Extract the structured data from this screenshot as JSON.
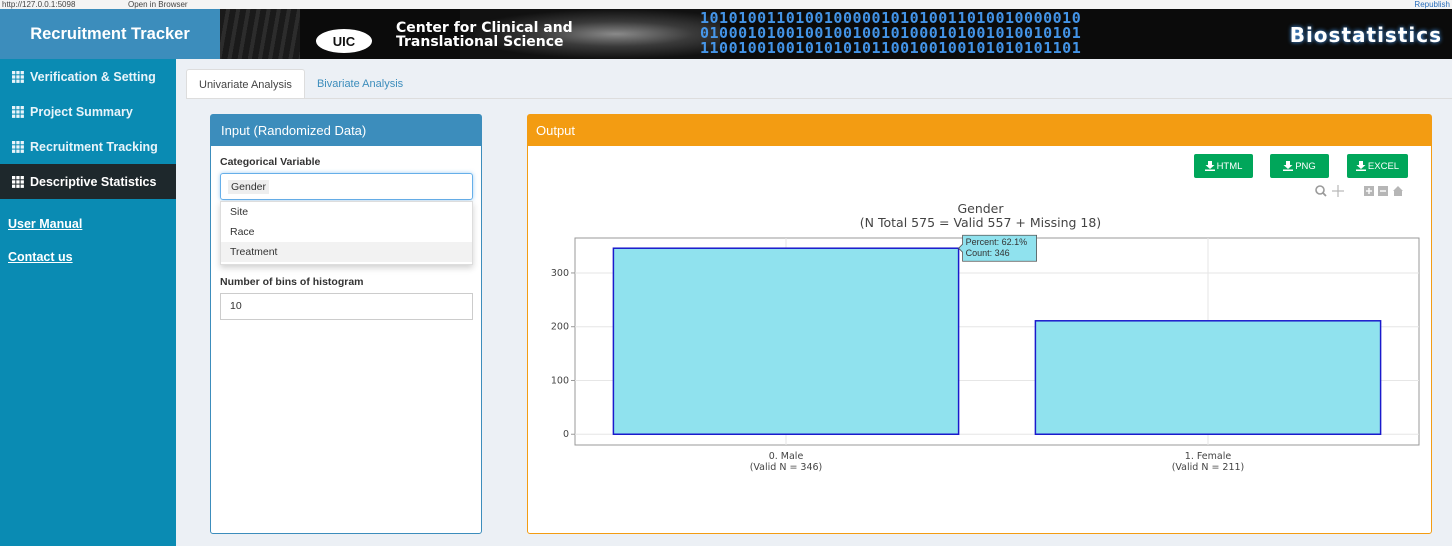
{
  "browser": {
    "url": "http://127.0.0.1:5098",
    "open_in_browser": "Open in Browser",
    "republish": "Republish"
  },
  "header": {
    "app_title": "Recruitment Tracker",
    "banner_logo": "UIC",
    "banner_line1": "Center for Clinical and",
    "banner_line2": "Translational Science",
    "banner_right": "Biostatistics",
    "banner_binary": [
      "1010100110100100000101010011010010000010",
      "0100010100100100100101000101001010010101",
      "1100100100101010101100100100101010101101"
    ]
  },
  "sidebar": {
    "items": [
      {
        "label": "Verification & Setting",
        "icon": "table-icon"
      },
      {
        "label": "Project Summary",
        "icon": "table-icon"
      },
      {
        "label": "Recruitment Tracking",
        "icon": "table-icon"
      },
      {
        "label": "Descriptive Statistics",
        "icon": "table-icon",
        "active": true
      }
    ],
    "links": [
      "User Manual",
      "Contact us"
    ]
  },
  "tabs": [
    "Univariate Analysis",
    "Bivariate Analysis"
  ],
  "input_panel": {
    "title": "Input (Randomized Data)",
    "categorical_label": "Categorical Variable",
    "selected_value": "Gender",
    "options": [
      "Site",
      "Race",
      "Treatment"
    ],
    "bins_label": "Number of bins of histogram",
    "bins_value": "10"
  },
  "output_panel": {
    "title": "Output",
    "buttons": [
      "HTML",
      "PNG",
      "EXCEL"
    ],
    "modebar_icons": [
      "zoom-icon",
      "pan-icon",
      "zoom-in-icon",
      "zoom-out-icon",
      "home-icon"
    ]
  },
  "chart_data": {
    "type": "bar",
    "title": "Gender",
    "subtitle": "(N Total 575 = Valid 557 + Missing 18)",
    "categories": [
      "0. Male",
      "1. Female"
    ],
    "category_sublabels": [
      "(Valid N = 346)",
      "(Valid N = 211)"
    ],
    "values": [
      346,
      211
    ],
    "yticks": [
      0,
      100,
      200,
      300
    ],
    "ylim": [
      -20,
      365
    ],
    "grid": true,
    "bar_fill": "#90e2ee",
    "bar_stroke": "#1a1acc",
    "tooltip": {
      "percent": "Percent: 62.1%",
      "count": "Count: 346"
    }
  },
  "colors": {
    "brand": "#3c8dbc",
    "sidebar": "#0a8bb3",
    "output_header": "#f39c12",
    "download_button": "#00a65a"
  }
}
